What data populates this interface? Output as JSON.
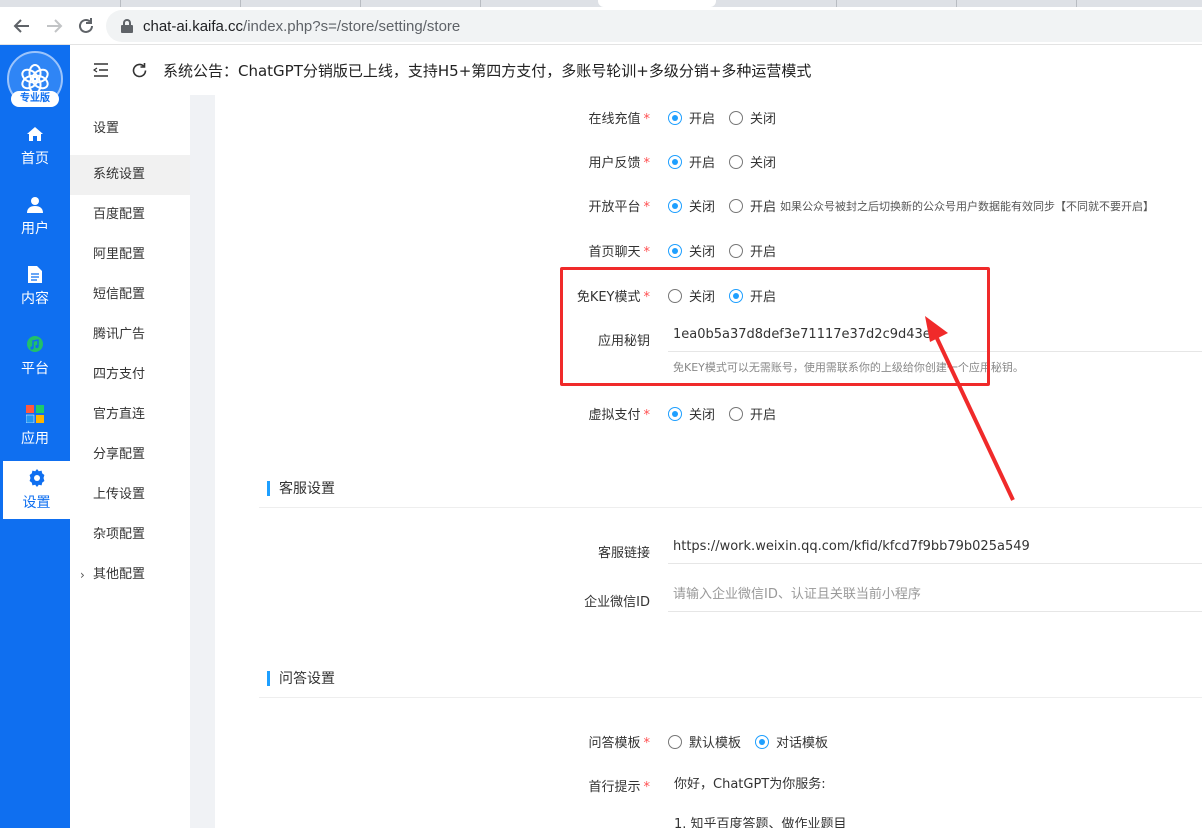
{
  "browser": {
    "url_host": "chat-ai.kaifa.cc",
    "url_path": "/index.php?s=/store/setting/store"
  },
  "rail": {
    "logo_badge": "专业版",
    "items": [
      {
        "label": "首页",
        "icon": "home-icon"
      },
      {
        "label": "用户",
        "icon": "user-icon"
      },
      {
        "label": "内容",
        "icon": "document-icon"
      },
      {
        "label": "平台",
        "icon": "platform-icon"
      },
      {
        "label": "应用",
        "icon": "apps-icon"
      },
      {
        "label": "设置",
        "icon": "gear-icon",
        "active": true
      }
    ]
  },
  "header": {
    "notice": "系统公告：ChatGPT分销版已上线，支持H5+第四方支付，多账号轮训+多级分销+多种运营模式"
  },
  "submenu": {
    "title": "设置",
    "items": [
      "系统设置",
      "百度配置",
      "阿里配置",
      "短信配置",
      "腾讯广告",
      "四方支付",
      "官方直连",
      "分享配置",
      "上传设置",
      "杂项配置",
      "其他配置"
    ]
  },
  "form": {
    "online_recharge": {
      "label": "在线充值",
      "opt1": "开启",
      "opt2": "关闭"
    },
    "user_feedback": {
      "label": "用户反馈",
      "opt1": "开启",
      "opt2": "关闭"
    },
    "open_platform": {
      "label": "开放平台",
      "opt1": "关闭",
      "opt2": "开启",
      "hint": "如果公众号被封之后切换新的公众号用户数据能有效同步【不同就不要开启】"
    },
    "home_chat": {
      "label": "首页聊天",
      "opt1": "关闭",
      "opt2": "开启"
    },
    "free_key": {
      "label": "免KEY模式",
      "opt1": "关闭",
      "opt2": "开启"
    },
    "app_secret": {
      "label": "应用秘钥",
      "value": "1ea0b5a37d8def3e71117e37d2c9d43e",
      "help": "免KEY模式可以无需账号，使用需联系你的上级给你创建一个应用秘钥。"
    },
    "virtual_pay": {
      "label": "虚拟支付",
      "opt1": "关闭",
      "opt2": "开启"
    },
    "section_service": "客服设置",
    "service_link": {
      "label": "客服链接",
      "value": "https://work.weixin.qq.com/kfid/kfcd7f9bb79b025a549"
    },
    "corp_wechat": {
      "label": "企业微信ID",
      "placeholder": "请输入企业微信ID、认证且关联当前小程序"
    },
    "section_qa": "问答设置",
    "qa_template": {
      "label": "问答模板",
      "opt1": "默认模板",
      "opt2": "对话模板"
    },
    "first_prompt": {
      "label": "首行提示",
      "line1": "你好，ChatGPT为你服务:",
      "line2": "1. 知乎百度答题、做作业题目"
    }
  },
  "colors": {
    "rail_blue": "#0f6ff0",
    "radio_blue": "#1e9fff",
    "annotation_red": "#f02a2a",
    "required_red": "#ff4d4f"
  }
}
